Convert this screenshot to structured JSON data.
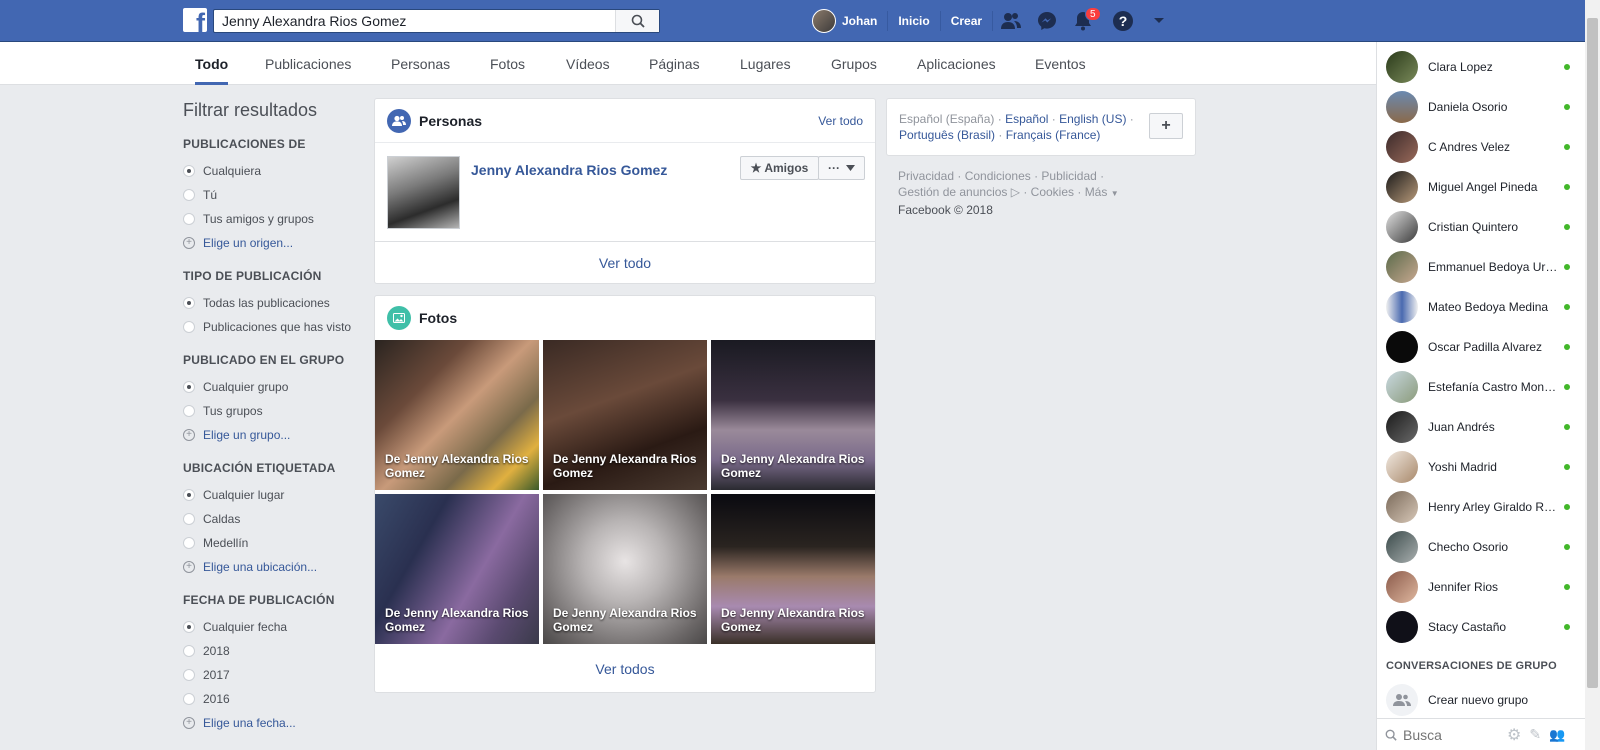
{
  "topbar": {
    "logo": "f",
    "search_value": "Jenny Alexandra Rios Gomez",
    "user_name": "Johan",
    "nav_home": "Inicio",
    "nav_create": "Crear",
    "notifications_count": "5",
    "help": "?"
  },
  "tabs": [
    "Todo",
    "Publicaciones",
    "Personas",
    "Fotos",
    "Vídeos",
    "Páginas",
    "Lugares",
    "Grupos",
    "Aplicaciones",
    "Eventos"
  ],
  "filters": {
    "title": "Filtrar resultados",
    "groups": [
      {
        "heading": "PUBLICACIONES DE",
        "options": [
          "Cualquiera",
          "Tú",
          "Tus amigos y grupos"
        ],
        "link": "Elige un origen..."
      },
      {
        "heading": "TIPO DE PUBLICACIÓN",
        "options": [
          "Todas las publicaciones",
          "Publicaciones que has visto"
        ],
        "link": ""
      },
      {
        "heading": "PUBLICADO EN EL GRUPO",
        "options": [
          "Cualquier grupo",
          "Tus grupos"
        ],
        "link": "Elige un grupo..."
      },
      {
        "heading": "UBICACIÓN ETIQUETADA",
        "options": [
          "Cualquier lugar",
          "Caldas",
          "Medellín"
        ],
        "link": "Elige una ubicación..."
      },
      {
        "heading": "FECHA DE PUBLICACIÓN",
        "options": [
          "Cualquier fecha",
          "2018",
          "2017",
          "2016"
        ],
        "link": "Elige una fecha..."
      }
    ]
  },
  "people": {
    "title": "Personas",
    "see_all_link": "Ver todo",
    "person_name": "Jenny Alexandra Rios Gomez",
    "friends_button": "★ Amigos",
    "more_button": "···",
    "footer_link": "Ver todo"
  },
  "photos": {
    "title": "Fotos",
    "captions": [
      "De Jenny Alexandra Rios Gomez",
      "De Jenny Alexandra Rios Gomez",
      "De Jenny Alexandra Rios Gomez",
      "De Jenny Alexandra Rios Gomez",
      "De Jenny Alexandra Rios Gomez",
      "De Jenny Alexandra Rios Gomez"
    ],
    "footer_link": "Ver todos"
  },
  "languages": {
    "current": "Español (España)",
    "others": [
      "Español",
      "English (US)",
      "Português (Brasil)",
      "Français (France)"
    ],
    "add": "+"
  },
  "footer": {
    "links": [
      "Privacidad",
      "Condiciones",
      "Publicidad",
      "Gestión de anuncios",
      "Cookies",
      "Más"
    ],
    "copyright": "Facebook © 2018"
  },
  "chat": {
    "friends": [
      "Clara Lopez",
      "Daniela Osorio",
      "C Andres Velez",
      "Miguel Angel Pineda",
      "Cristian Quintero",
      "Emmanuel Bedoya Uribe",
      "Mateo Bedoya Medina",
      "Oscar Padilla Alvarez",
      "Estefanía Castro Montoya",
      "Juan Andrés",
      "Yoshi Madrid",
      "Henry Arley Giraldo Ramirez",
      "Checho Osorio",
      "Jennifer Rios",
      "Stacy Castaño"
    ],
    "group_heading": "CONVERSACIONES DE GRUPO",
    "new_group": "Crear nuevo grupo",
    "search_placeholder": "Busca"
  },
  "colors": {
    "brand": "#4267b2",
    "link": "#365899",
    "online": "#42b72a",
    "badge": "#fa3e3e"
  }
}
